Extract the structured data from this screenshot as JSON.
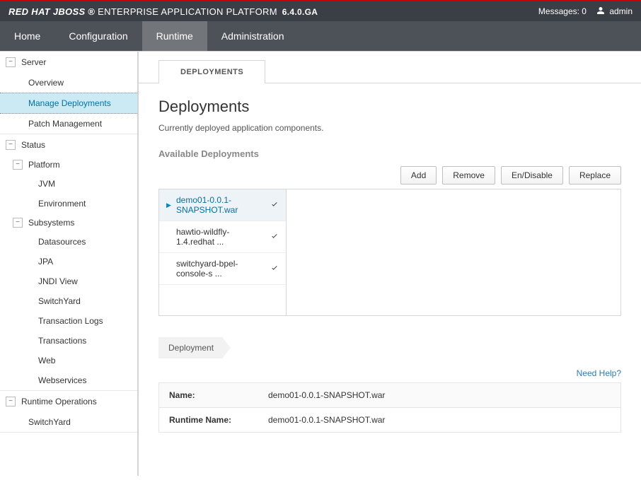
{
  "brand": {
    "redhat": "RED HAT",
    "jboss": "JBOSS",
    "eap": "ENTERPRISE APPLICATION PLATFORM",
    "version": "6.4.0.GA"
  },
  "topbar": {
    "messages_label": "Messages: 0",
    "user": "admin"
  },
  "navtabs": {
    "home": "Home",
    "configuration": "Configuration",
    "runtime": "Runtime",
    "administration": "Administration"
  },
  "sidebar": {
    "server_label": "Server",
    "server_items": {
      "overview": "Overview",
      "manage_deployments": "Manage Deployments",
      "patch_management": "Patch Management"
    },
    "status_label": "Status",
    "platform_label": "Platform",
    "platform_items": {
      "jvm": "JVM",
      "environment": "Environment"
    },
    "subsystems_label": "Subsystems",
    "subsystem_items": {
      "datasources": "Datasources",
      "jpa": "JPA",
      "jndi": "JNDI View",
      "switchyard": "SwitchYard",
      "txlogs": "Transaction Logs",
      "tx": "Transactions",
      "web": "Web",
      "ws": "Webservices"
    },
    "runtime_ops_label": "Runtime Operations",
    "runtime_ops_items": {
      "switchyard": "SwitchYard"
    }
  },
  "content": {
    "tab_label": "DEPLOYMENTS",
    "title": "Deployments",
    "subtitle": "Currently deployed application components.",
    "available_label": "Available Deployments",
    "actions": {
      "add": "Add",
      "remove": "Remove",
      "endisable": "En/Disable",
      "replace": "Replace"
    },
    "deployments": [
      {
        "name": "demo01-0.0.1-SNAPSHOT.war",
        "enabled": true,
        "selected": true
      },
      {
        "name": "hawtio-wildfly-1.4.redhat ...",
        "enabled": true,
        "selected": false
      },
      {
        "name": "switchyard-bpel-console-s ...",
        "enabled": true,
        "selected": false
      }
    ],
    "breadcrumb": "Deployment",
    "help_link": "Need Help?",
    "detail": {
      "name_label": "Name:",
      "name_value": "demo01-0.0.1-SNAPSHOT.war",
      "runtime_label": "Runtime Name:",
      "runtime_value": "demo01-0.0.1-SNAPSHOT.war"
    }
  }
}
